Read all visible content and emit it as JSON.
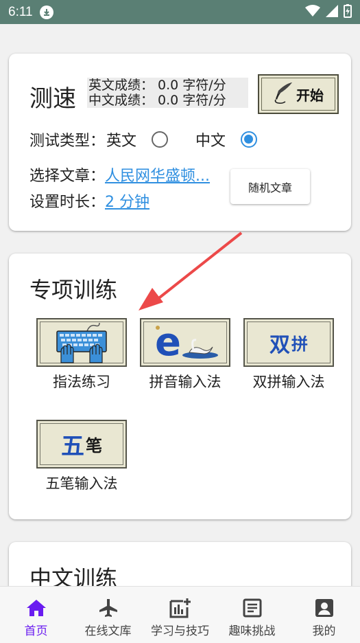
{
  "status_bar": {
    "time": "6:11"
  },
  "speed_test": {
    "title": "测速",
    "english_score": "英文成绩： 0.0 字符/分",
    "chinese_score": "中文成绩： 0.0 字符/分",
    "start_label": "开始",
    "type_label": "测试类型：",
    "type_options": [
      "英文",
      "中文"
    ],
    "selected_type": "中文",
    "article_label": "选择文章：",
    "article_value": "人民网华盛顿...",
    "duration_label": "设置时长：",
    "duration_value": "2 分钟",
    "random_button": "随机文章"
  },
  "special_training": {
    "title": "专项训练",
    "tiles": [
      {
        "label": "指法练习",
        "icon": "keyboard-hands-icon"
      },
      {
        "label": "拼音输入法",
        "icon": "pinyin-e-swan-icon",
        "glyph": "e"
      },
      {
        "label": "双拼输入法",
        "icon": "shuangpin-icon",
        "glyph": "双拼"
      },
      {
        "label": "五笔输入法",
        "icon": "wubi-icon",
        "glyph": "五笔"
      }
    ]
  },
  "chinese_training": {
    "title": "中文训练"
  },
  "bottom_nav": [
    {
      "label": "首页",
      "icon": "home-icon",
      "active": true
    },
    {
      "label": "在线文库",
      "icon": "airplane-icon",
      "active": false
    },
    {
      "label": "学习与技巧",
      "icon": "chart-add-icon",
      "active": false
    },
    {
      "label": "趣味挑战",
      "icon": "article-icon",
      "active": false
    },
    {
      "label": "我的",
      "icon": "account-box-icon",
      "active": false
    }
  ],
  "colors": {
    "status_bar": "#5a7f74",
    "accent_blue": "#2f8fe0",
    "nav_active": "#6a1cf0",
    "annotation_arrow": "#ec4949",
    "tile_background": "#e9e7d2"
  }
}
